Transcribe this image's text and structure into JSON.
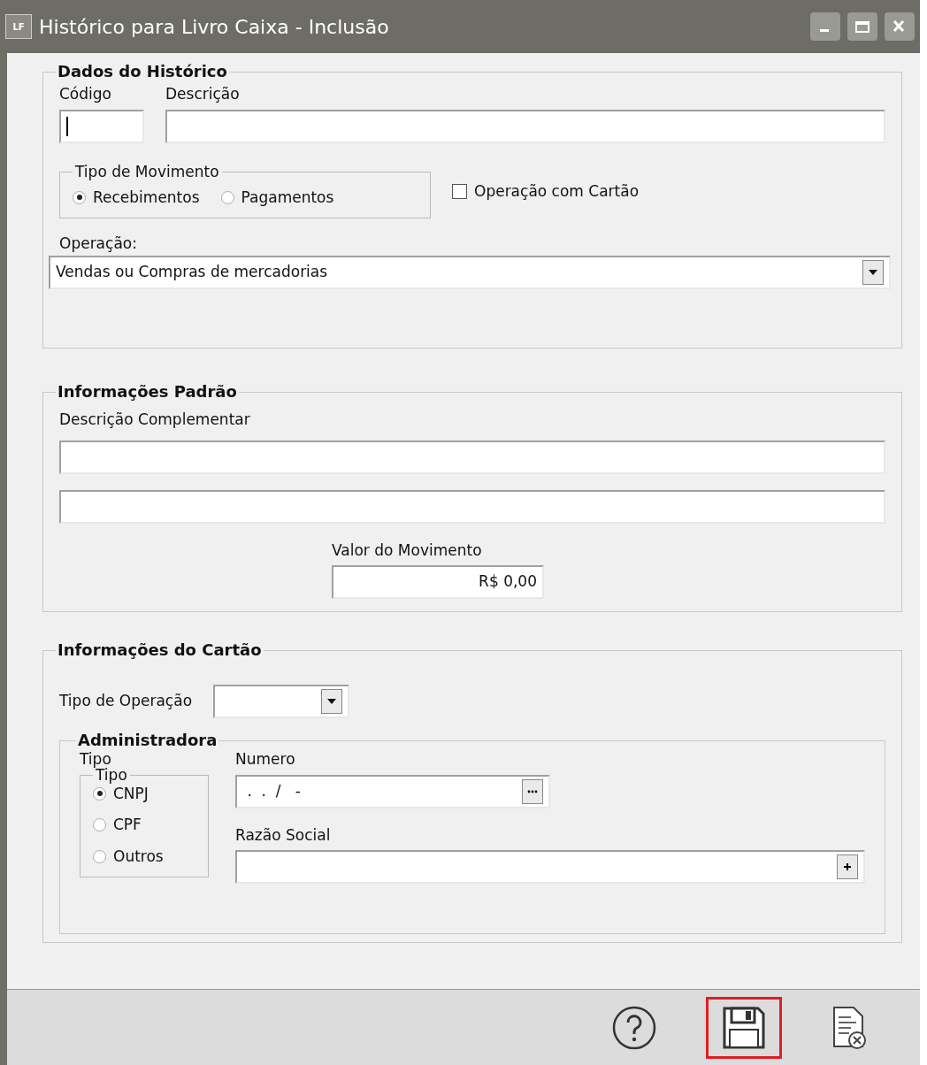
{
  "window": {
    "title": "Histórico para Livro Caixa - Inclusão",
    "icon_text": "LF"
  },
  "dados": {
    "legend": "Dados do Histórico",
    "codigo": {
      "label": "Código"
    },
    "descricao": {
      "label": "Descrição"
    },
    "tipo_movimento": {
      "legend": "Tipo de Movimento",
      "options": [
        {
          "label": "Recebimentos",
          "selected": true
        },
        {
          "label": "Pagamentos",
          "selected": false
        }
      ]
    },
    "cartao_check": {
      "label": "Operação com Cartão",
      "checked": false
    },
    "operacao": {
      "label": "Operação:",
      "value": "Vendas ou Compras de mercadorias"
    }
  },
  "padrao": {
    "legend": "Informações Padrão",
    "complementar_label": "Descrição Complementar",
    "valor": {
      "label": "Valor do Movimento",
      "value": "R$ 0,00"
    }
  },
  "cartao": {
    "legend": "Informações do Cartão",
    "tipo_operacao": {
      "label": "Tipo de Operação"
    },
    "administradora": {
      "legend": "Administradora",
      "tipo_label": "Tipo",
      "tipo_group": {
        "legend": "Tipo",
        "options": [
          {
            "label": "CNPJ",
            "selected": true
          },
          {
            "label": "CPF",
            "selected": false
          },
          {
            "label": "Outros",
            "selected": false
          }
        ]
      },
      "numero": {
        "label": "Numero",
        "value": " .  .  /   -"
      },
      "razao": {
        "label": "Razão Social"
      }
    }
  },
  "footer_buttons": [
    {
      "kind": "help",
      "highlighted": false
    },
    {
      "kind": "save",
      "highlighted": true
    },
    {
      "kind": "cancel",
      "highlighted": false
    }
  ]
}
